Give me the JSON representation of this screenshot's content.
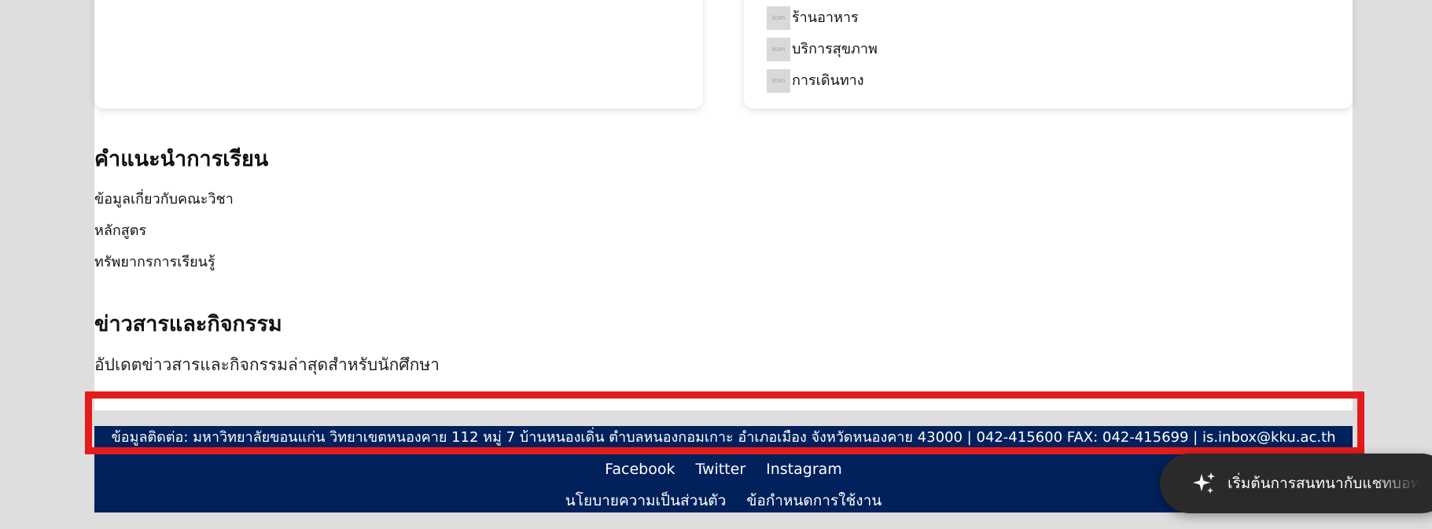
{
  "services": {
    "items": [
      {
        "icon_text": "Icon",
        "label": "ร้านอาหาร"
      },
      {
        "icon_text": "Icon",
        "label": "บริการสุขภาพ"
      },
      {
        "icon_text": "Icon",
        "label": "การเดินทาง"
      }
    ]
  },
  "study_guide": {
    "title": "คำแนะนำการเรียน",
    "links": [
      "ข้อมูลเกี่ยวกับคณะวิชา",
      "หลักสูตร",
      "ทรัพยากรการเรียนรู้"
    ]
  },
  "news": {
    "title": "ข่าวสารและกิจกรรม",
    "description": "อัปเดตข่าวสารและกิจกรรมล่าสุดสำหรับนักศึกษา"
  },
  "footer": {
    "contact": "ข้อมูลติดต่อ: มหาวิทยาลัยขอนแก่น วิทยาเขตหนองคาย 112 หมู่ 7 บ้านหนองเดิ่น ตำบลหนองกอมเกาะ อำเภอเมือง จังหวัดหนองคาย 43000 | 042-415600 FAX: 042-415699 | is.inbox@kku.ac.th",
    "social": [
      "Facebook",
      "Twitter",
      "Instagram"
    ],
    "policies": [
      "นโยบายความเป็นส่วนตัว",
      "ข้อกำหนดการใช้งาน"
    ]
  },
  "chat": {
    "label": "เริ่มต้นการสนทนากับแชทบอท",
    "icon": "sparkle-icon"
  },
  "colors": {
    "footer_bg": "#00215b",
    "highlight": "#e51b1b",
    "chat_bg": "#2a2a2a"
  }
}
